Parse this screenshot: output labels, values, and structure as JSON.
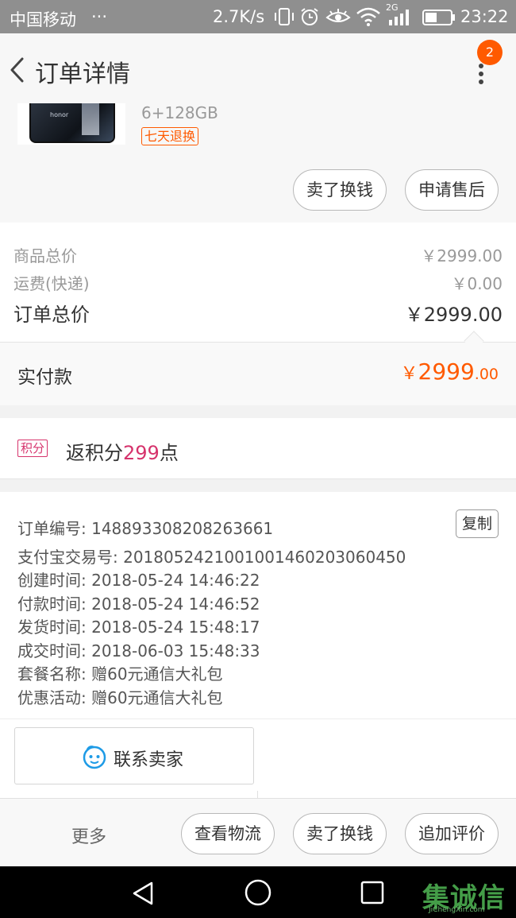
{
  "status_bar": {
    "carrier": "中国移动",
    "carrier_dots": "···",
    "net_speed": "2.7K/s",
    "network_type": "2G",
    "time": "23:22",
    "icons": [
      "vibrate-icon",
      "alarm-icon",
      "eye-icon",
      "wifi-icon",
      "signal-icon",
      "battery-icon"
    ]
  },
  "header": {
    "title": "订单详情",
    "badge_count": "2",
    "icons": [
      "back-arrow-icon",
      "more-vertical-icon"
    ]
  },
  "product": {
    "spec": "6+128GB",
    "tag": "七天退换",
    "phone_brand_text": "honor",
    "actions": [
      "卖了换钱",
      "申请售后"
    ]
  },
  "prices": {
    "rows": [
      {
        "label": "商品总价",
        "value": "￥2999.00"
      },
      {
        "label": "运费(快递)",
        "value": "￥0.00"
      }
    ],
    "total_label": "订单总价",
    "total_value": "￥2999.00",
    "paid_label": "实付款",
    "paid_currency": "￥",
    "paid_int": "2999",
    "paid_dec": ".00"
  },
  "points": {
    "tag": "积分",
    "prefix": "返积分",
    "value": "299",
    "suffix": "点"
  },
  "order_info": {
    "copy_label": "复制",
    "rows": [
      "订单编号: 148893308208263661",
      "支付宝交易号: 2018052421001001460203060450",
      "创建时间: 2018-05-24 14:46:22",
      "付款时间: 2018-05-24 14:46:52",
      "发货时间: 2018-05-24 15:48:17",
      "成交时间: 2018-06-03 15:48:33",
      "套餐名称: 赠60元通信大礼包",
      "优惠活动: 赠60元通信大礼包"
    ]
  },
  "contact": {
    "label": "联系卖家"
  },
  "bottom_bar": {
    "more_label": "更多",
    "buttons": [
      "查看物流",
      "卖了换钱",
      "追加评价"
    ]
  },
  "nav_bar": {
    "icons": [
      "back-triangle-icon",
      "home-circle-icon",
      "recents-square-icon"
    ]
  },
  "watermark": {
    "main": "集诚信",
    "sub": "JiChengXin.com"
  },
  "colors": {
    "accent": "#ff5a00",
    "points": "#d6336c",
    "status_bar": "#8f8f8f"
  }
}
